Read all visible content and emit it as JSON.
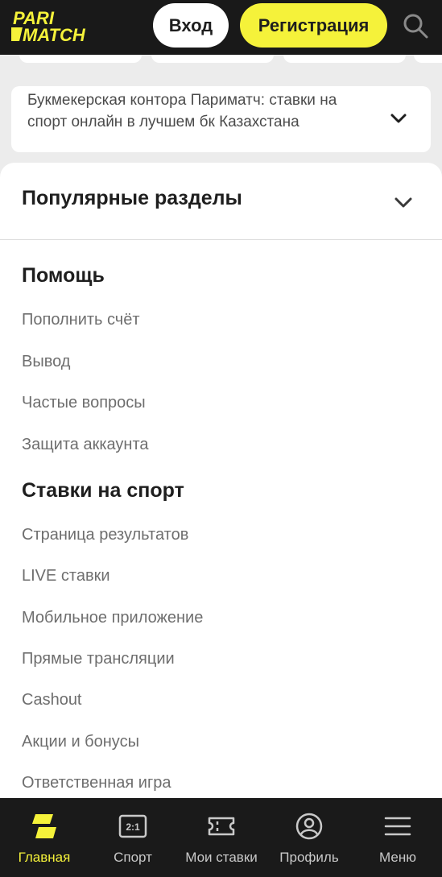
{
  "header": {
    "logo_text_top": "PARI",
    "logo_text_bottom": "MATCH",
    "login_label": "Вход",
    "register_label": "Регистрация",
    "search_icon": "search-icon"
  },
  "seo": {
    "text": "Букмекерская контора Париматч: ставки на спорт онлайн в лучшем бк Казахстана",
    "chevron_icon": "chevron-down-icon"
  },
  "popular": {
    "title": "Популярные разделы",
    "chevron_icon": "chevron-down-icon"
  },
  "help": {
    "title": "Помощь",
    "links": [
      "Пополнить счёт",
      "Вывод",
      "Частые вопросы",
      "Защита аккаунта"
    ]
  },
  "sports": {
    "title": "Ставки на спорт",
    "links": [
      "Страница результатов",
      "LIVE ставки",
      "Мобильное приложение",
      "Прямые трансляции",
      "Cashout",
      "Акции и бонусы",
      "Ответственная игра"
    ]
  },
  "bottom_nav": {
    "items": [
      {
        "label": "Главная",
        "icon": "home-logo-icon",
        "active": true
      },
      {
        "label": "Спорт",
        "icon": "scoreboard-icon",
        "active": false
      },
      {
        "label": "Мои ставки",
        "icon": "ticket-icon",
        "active": false
      },
      {
        "label": "Профиль",
        "icon": "profile-icon",
        "active": false
      },
      {
        "label": "Меню",
        "icon": "menu-icon",
        "active": false
      }
    ]
  },
  "colors": {
    "accent": "#f5f23a",
    "header_bg": "#191919",
    "nav_bg": "#1a1a1a",
    "page_bg": "#ececec"
  }
}
